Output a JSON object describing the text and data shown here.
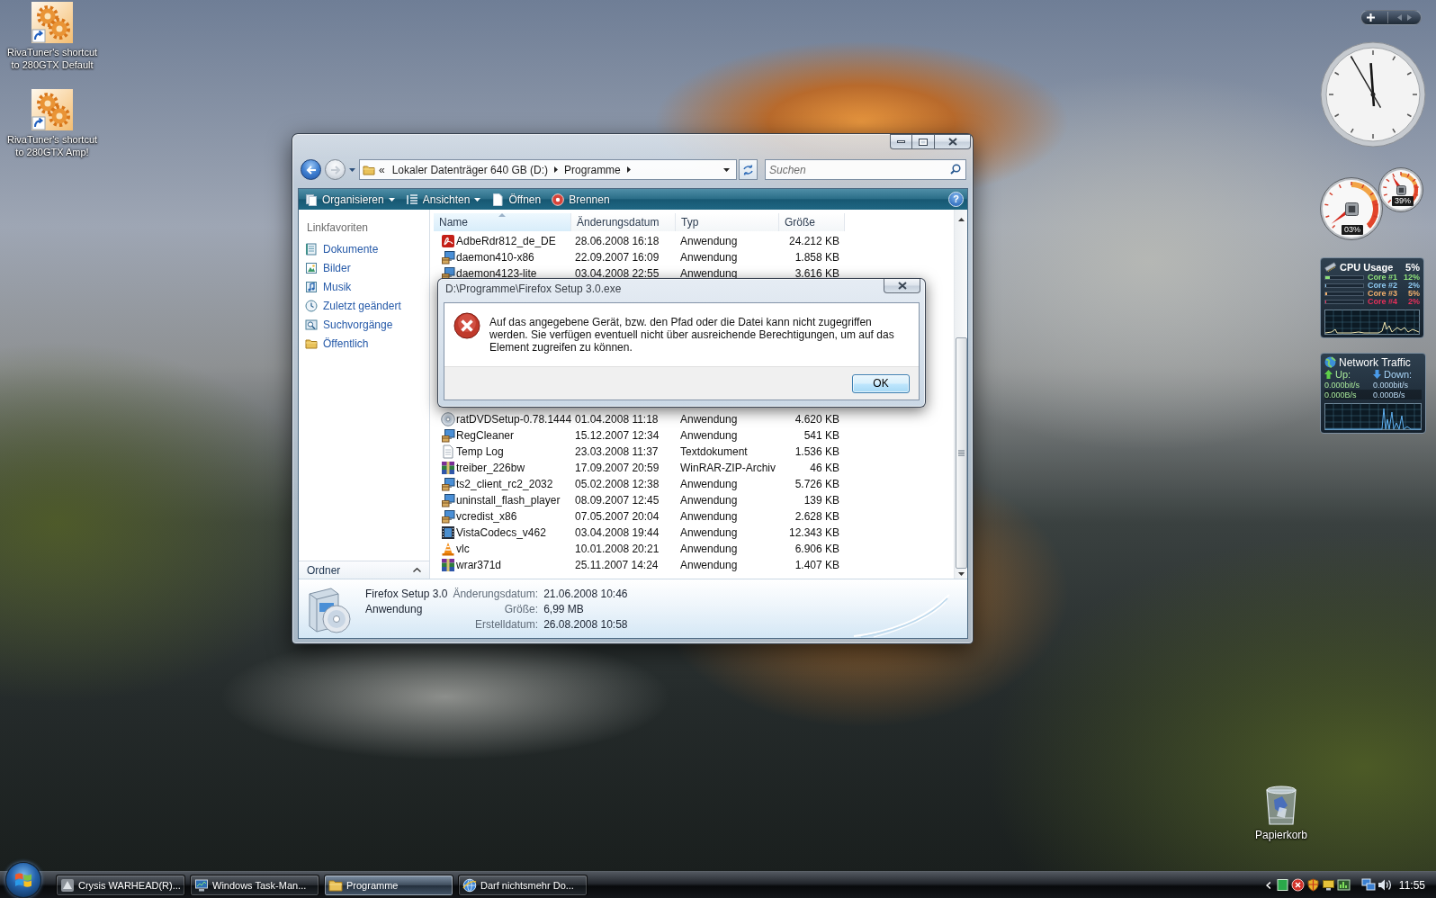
{
  "desktop_icons": [
    {
      "label": "RivaTuner's shortcut to 280GTX Default"
    },
    {
      "label": "RivaTuner's shortcut to 280GTX Amp!"
    }
  ],
  "recycle_bin": {
    "label": "Papierkorb"
  },
  "explorer": {
    "address": {
      "overflow": "«",
      "crumbs": [
        "Lokaler Datenträger 640 GB (D:)",
        "Programme"
      ]
    },
    "search": {
      "placeholder": "Suchen"
    },
    "toolbar": [
      {
        "label": "Organisieren",
        "kind": "organize",
        "dropdown": true
      },
      {
        "label": "Ansichten",
        "kind": "views",
        "dropdown": true
      },
      {
        "label": "Öffnen",
        "kind": "open",
        "dropdown": false
      },
      {
        "label": "Brennen",
        "kind": "burn",
        "dropdown": false
      }
    ],
    "help": "?",
    "nav": {
      "heading": "Linkfavoriten",
      "items": [
        {
          "label": "Dokumente",
          "kind": "documents"
        },
        {
          "label": "Bilder",
          "kind": "pictures"
        },
        {
          "label": "Musik",
          "kind": "music"
        },
        {
          "label": "Zuletzt geändert",
          "kind": "recent"
        },
        {
          "label": "Suchvorgänge",
          "kind": "searches"
        },
        {
          "label": "Öffentlich",
          "kind": "public"
        }
      ],
      "folders": "Ordner"
    },
    "columns": [
      {
        "label": "Name",
        "sorted": true
      },
      {
        "label": "Änderungsdatum",
        "sorted": false
      },
      {
        "label": "Typ",
        "sorted": false
      },
      {
        "label": "Größe",
        "sorted": false
      }
    ],
    "rows_above_dialog": [
      {
        "name": "AdbeRdr812_de_DE",
        "date": "28.06.2008 16:18",
        "type": "Anwendung",
        "size": "24.212 KB",
        "kind": "pdf"
      },
      {
        "name": "daemon410-x86",
        "date": "22.09.2007 16:09",
        "type": "Anwendung",
        "size": "1.858 KB",
        "kind": "installer"
      },
      {
        "name": "daemon4123-lite",
        "date": "03.04.2008 22:55",
        "type": "Anwendung",
        "size": "3.616 KB",
        "kind": "installer"
      }
    ],
    "rows_below_dialog": [
      {
        "name": "ratDVDSetup-0.78.1444",
        "date": "01.04.2008 11:18",
        "type": "Anwendung",
        "size": "4.620 KB",
        "kind": "disc"
      },
      {
        "name": "RegCleaner",
        "date": "15.12.2007 12:34",
        "type": "Anwendung",
        "size": "541 KB",
        "kind": "installer"
      },
      {
        "name": "Temp Log",
        "date": "23.03.2008 11:37",
        "type": "Textdokument",
        "size": "1.536 KB",
        "kind": "text"
      },
      {
        "name": "treiber_226bw",
        "date": "17.09.2007 20:59",
        "type": "WinRAR-ZIP-Archiv",
        "size": "46 KB",
        "kind": "archive"
      },
      {
        "name": "ts2_client_rc2_2032",
        "date": "05.02.2008 12:38",
        "type": "Anwendung",
        "size": "5.726 KB",
        "kind": "installer"
      },
      {
        "name": "uninstall_flash_player",
        "date": "08.09.2007 12:45",
        "type": "Anwendung",
        "size": "139 KB",
        "kind": "installer"
      },
      {
        "name": "vcredist_x86",
        "date": "07.05.2007 20:04",
        "type": "Anwendung",
        "size": "2.628 KB",
        "kind": "installer"
      },
      {
        "name": "VistaCodecs_v462",
        "date": "03.04.2008 19:44",
        "type": "Anwendung",
        "size": "12.343 KB",
        "kind": "film"
      },
      {
        "name": "vlc",
        "date": "10.01.2008 20:21",
        "type": "Anwendung",
        "size": "6.906 KB",
        "kind": "cone"
      },
      {
        "name": "wrar371d",
        "date": "25.11.2007 14:24",
        "type": "Anwendung",
        "size": "1.407 KB",
        "kind": "archive"
      }
    ],
    "details": {
      "name": "Firefox Setup 3.0",
      "type": "Anwendung",
      "fields": [
        {
          "label": "Änderungsdatum:",
          "value": "21.06.2008 10:46"
        },
        {
          "label": "Größe:",
          "value": "6,99 MB"
        },
        {
          "label": "Erstelldatum:",
          "value": "26.08.2008 10:58"
        }
      ]
    }
  },
  "dialog": {
    "title": "D:\\Programme\\Firefox Setup 3.0.exe",
    "message": "Auf das angegebene Gerät, bzw. den Pfad oder die Datei kann nicht zugegriffen werden. Sie verfügen eventuell nicht über ausreichende Berechtigungen, um auf das Element zugreifen zu können.",
    "button": "OK"
  },
  "gadgets": {
    "meter": {
      "dials": [
        {
          "reading": "03%"
        },
        {
          "reading": "39%"
        }
      ]
    },
    "cpu": {
      "title": "CPU Usage",
      "total": "5%",
      "cores": [
        {
          "label": "Core #1",
          "reading": "12%",
          "level": 0.12,
          "color": "#8ee07a"
        },
        {
          "label": "Core #2",
          "reading": "2%",
          "level": 0.02,
          "color": "#8ec8f0"
        },
        {
          "label": "Core #3",
          "reading": "5%",
          "level": 0.05,
          "color": "#f2b06c"
        },
        {
          "label": "Core #4",
          "reading": "2%",
          "level": 0.02,
          "color": "#e8305a"
        }
      ]
    },
    "network": {
      "title": "Network Traffic",
      "up_label": "Up:",
      "down_label": "Down:",
      "up_bits": "0.000bit/s",
      "down_bits": "0.000bit/s",
      "up_bytes": "0.000B/s",
      "down_bytes": "0.000B/s"
    }
  },
  "taskbar": {
    "buttons": [
      {
        "label": "Crysis WARHEAD(R)...",
        "kind": "game",
        "selected": false
      },
      {
        "label": "Windows Task-Man...",
        "kind": "monitor",
        "selected": false
      },
      {
        "label": "Programme",
        "kind": "folder",
        "selected": true
      },
      {
        "label": "Darf nichtsmehr Do...",
        "kind": "browser",
        "selected": false
      }
    ],
    "clock": "11:55"
  }
}
